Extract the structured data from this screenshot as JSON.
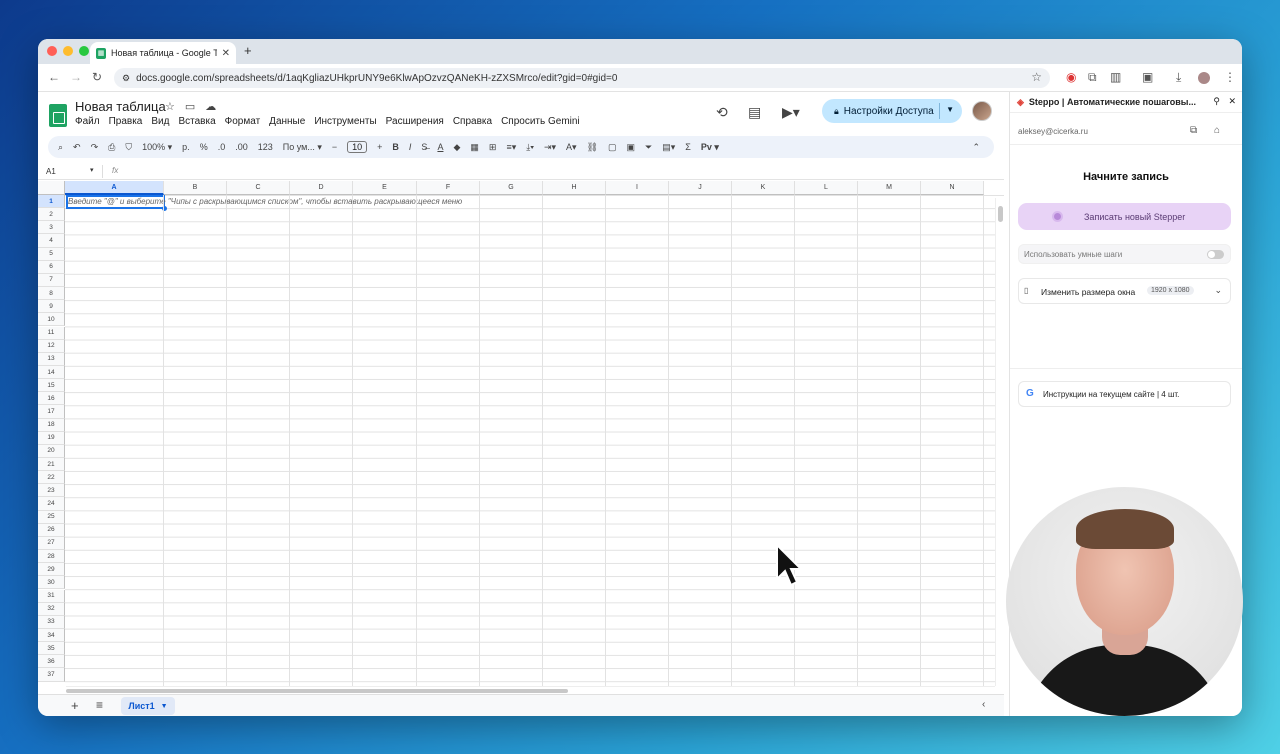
{
  "browser": {
    "tab_title": "Новая таблица - Google Таб",
    "tab_icon": "sheets-icon",
    "url": "docs.google.com/spreadsheets/d/1aqKgliazUHkprUNY9e6KlwApOzvzQANeKH-zZXSMrco/edit?gid=0#gid=0"
  },
  "sheets": {
    "title": "Новая таблица",
    "menu": [
      "Файл",
      "Правка",
      "Вид",
      "Вставка",
      "Формат",
      "Данные",
      "Инструменты",
      "Расширения",
      "Справка",
      "Спросить Gemini"
    ],
    "share_label": "Настройки Доступа",
    "toolbar": {
      "zoom": "100%",
      "currency": "р.",
      "percent": "%",
      "dec_less": ".0",
      "dec_more": ".00",
      "format_123": "123",
      "font": "По ум...",
      "font_size": "10",
      "bold": "B",
      "italic": "I",
      "sum": "Σ",
      "input_tools": "Рv"
    },
    "name_box": "A1",
    "fx": "fx",
    "columns": [
      "A",
      "B",
      "C",
      "D",
      "E",
      "F",
      "G",
      "H",
      "I",
      "J",
      "K",
      "L",
      "M",
      "N"
    ],
    "rows": [
      "1",
      "2",
      "3",
      "4",
      "5",
      "6",
      "7",
      "8",
      "9",
      "10",
      "11",
      "12",
      "13",
      "14",
      "15",
      "16",
      "17",
      "18",
      "19",
      "20",
      "21",
      "22",
      "23",
      "24",
      "25",
      "26",
      "27",
      "28",
      "29",
      "30",
      "31",
      "32",
      "33",
      "34",
      "35",
      "36",
      "37"
    ],
    "cell_hint": "Введите \"@\" и выберите \"Чипы с раскрывающимся списком\", чтобы вставить раскрывающееся меню",
    "sheet_tab": "Лист1"
  },
  "sidepanel": {
    "header": "Steppo | Автоматические пошаговы...",
    "email": "aleksey@cicerka.ru",
    "heading": "Начните запись",
    "record_button": "Записать новый Stepper",
    "smart_steps": "Использовать умные шаги",
    "smart_steps_enabled": false,
    "resize_label": "Изменить размера окна",
    "resize_badge": "1920 x 1080",
    "instructions": "Инструкции на текущем сайте | 4 шт."
  },
  "colors": {
    "accent": "#1a73e8",
    "sheets_green": "#1ea362",
    "share_bg": "#c2e7ff",
    "record_bg": "#e8d3f6"
  }
}
